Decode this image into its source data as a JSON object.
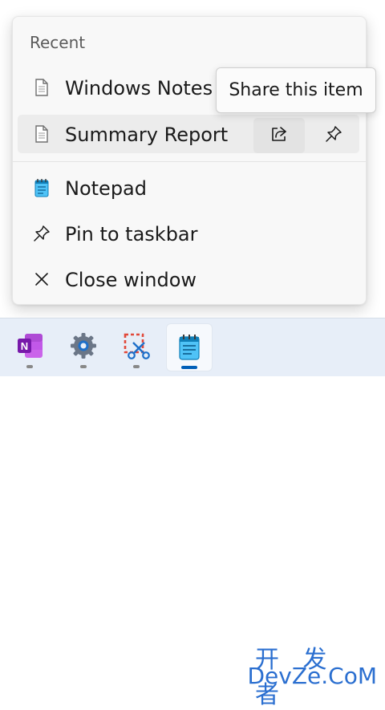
{
  "jump_list": {
    "section_title": "Recent",
    "recent_items": [
      {
        "label": "Windows Notes",
        "icon": "document-icon"
      },
      {
        "label": "Summary Report",
        "icon": "document-icon"
      }
    ],
    "share_icon": "share-icon",
    "pin_item_icon": "pin-icon",
    "tooltip": "Share this item",
    "tasks": [
      {
        "label": "Notepad",
        "icon": "notepad-icon"
      },
      {
        "label": "Pin to taskbar",
        "icon": "pin-icon"
      },
      {
        "label": "Close window",
        "icon": "close-icon"
      }
    ]
  },
  "taskbar": {
    "apps": [
      {
        "icon": "onenote-icon",
        "letter": "N",
        "active": false
      },
      {
        "icon": "settings-gear-icon",
        "active": false
      },
      {
        "icon": "snipping-tool-icon",
        "active": false
      },
      {
        "icon": "notepad-icon",
        "active": true
      }
    ]
  },
  "watermark": {
    "line1": "开 发 者",
    "line2": "DevZe.CoM"
  },
  "colors": {
    "accent": "#005fb8",
    "watermark": "#2b6fd0",
    "onenote": "#7719aa"
  }
}
